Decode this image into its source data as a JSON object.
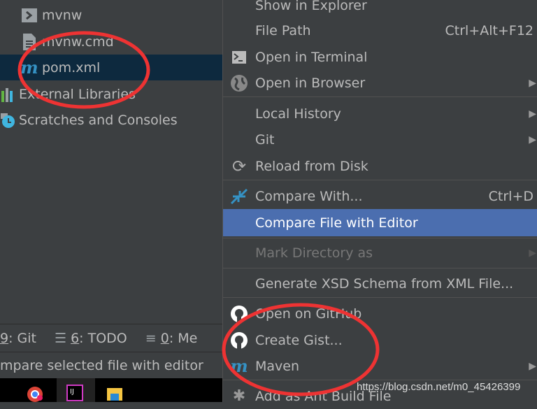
{
  "project_tree": {
    "items": [
      {
        "label": "mvnw",
        "icon": "shell-script-icon"
      },
      {
        "label": "mvnw.cmd",
        "icon": "text-file-icon"
      },
      {
        "label": "pom.xml",
        "icon": "maven-icon",
        "selected": true
      },
      {
        "label": "External Libraries",
        "icon": "libraries-icon"
      },
      {
        "label": "Scratches and Consoles",
        "icon": "scratches-icon"
      }
    ]
  },
  "tool_tabs": [
    {
      "num": "9",
      "label": ": Git"
    },
    {
      "num": "6",
      "label": ": TODO"
    },
    {
      "num": "0",
      "label": ": Me"
    }
  ],
  "status_text": "mpare selected file with editor",
  "context_menu": {
    "items": [
      {
        "label": "Show in Explorer"
      },
      {
        "label": "File Path",
        "shortcut": "Ctrl+Alt+F12"
      },
      {
        "label": "Open in Terminal",
        "icon": "terminal-icon"
      },
      {
        "label": "Open in Browser",
        "icon": "globe-icon",
        "submenu": true
      },
      {
        "label": "Local History",
        "submenu": true
      },
      {
        "label": "Git",
        "submenu": true
      },
      {
        "label": "Reload from Disk",
        "icon": "reload-icon"
      },
      {
        "label": "Compare With...",
        "icon": "compare-icon",
        "shortcut": "Ctrl+D"
      },
      {
        "label": "Compare File with Editor",
        "highlighted": true
      },
      {
        "label": "Mark Directory as",
        "disabled": true,
        "submenu": true
      },
      {
        "label": "Generate XSD Schema from XML File..."
      },
      {
        "label": "Open on GitHub",
        "icon": "github-icon"
      },
      {
        "label": "Create Gist...",
        "icon": "github-icon"
      },
      {
        "label": "Maven",
        "icon": "maven-icon",
        "submenu": true
      },
      {
        "label": "Add as Ant Build File",
        "icon": "ant-icon"
      }
    ]
  },
  "watermark": "https://blog.csdn.net/m0_45426399",
  "colors": {
    "background": "#3c3f41",
    "selection": "#0d293e",
    "highlight": "#4b6eaf",
    "annotation": "#ee3333"
  }
}
